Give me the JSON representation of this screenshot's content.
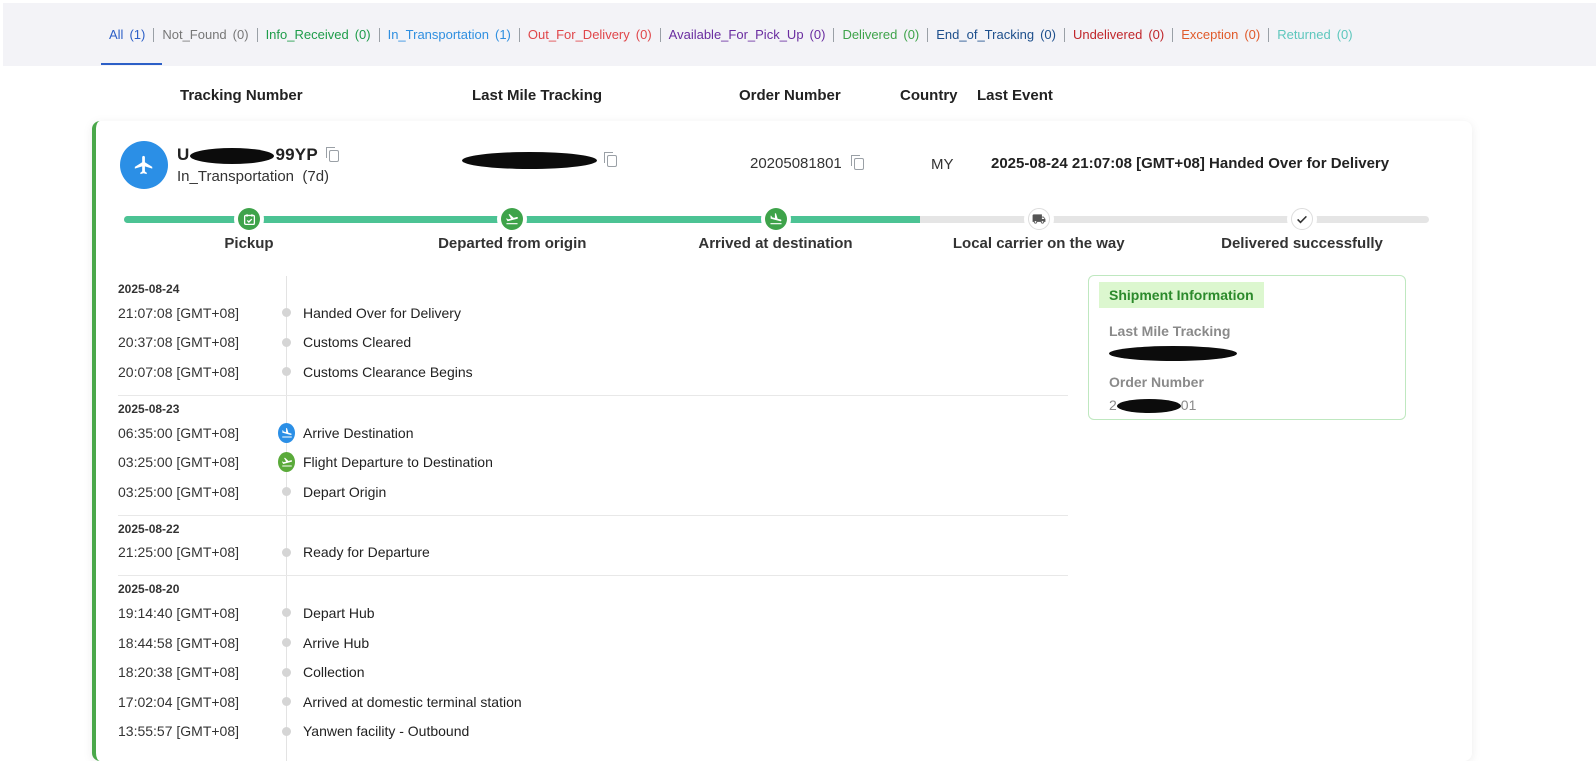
{
  "tabs": [
    {
      "label": "All",
      "count": "(1)",
      "color": "#2c5fc7",
      "active": true
    },
    {
      "label": "Not_Found",
      "count": "(0)",
      "color": "#777777"
    },
    {
      "label": "Info_Received",
      "count": "(0)",
      "color": "#1e9c4a"
    },
    {
      "label": "In_Transportation",
      "count": "(1)",
      "color": "#2f8fe0"
    },
    {
      "label": "Out_For_Delivery",
      "count": "(0)",
      "color": "#e0464a"
    },
    {
      "label": "Available_For_Pick_Up",
      "count": "(0)",
      "color": "#6a2da0"
    },
    {
      "label": "Delivered",
      "count": "(0)",
      "color": "#3ea34a"
    },
    {
      "label": "End_of_Tracking",
      "count": "(0)",
      "color": "#1d4f8c"
    },
    {
      "label": "Undelivered",
      "count": "(0)",
      "color": "#c0262b"
    },
    {
      "label": "Exception",
      "count": "(0)",
      "color": "#e05a2a"
    },
    {
      "label": "Returned",
      "count": "(0)",
      "color": "#5ec7bd"
    }
  ],
  "columns": {
    "tracking_number": "Tracking Number",
    "last_mile": "Last Mile Tracking",
    "order_number": "Order Number",
    "country": "Country",
    "last_event": "Last Event"
  },
  "shipment": {
    "tracking_prefix": "U",
    "tracking_suffix": "99YP",
    "status": "In_Transportation",
    "duration": "(7d)",
    "order_number": "20205081801",
    "country": "MY",
    "last_event": "2025-08-24 21:07:08 [GMT+08] Handed Over for Delivery"
  },
  "progress": {
    "fraction": 0.61,
    "steps": [
      {
        "label": "Pickup",
        "icon": "calendar-check-icon",
        "done": true
      },
      {
        "label": "Departed from origin",
        "icon": "plane-departure-icon",
        "done": true
      },
      {
        "label": "Arrived at destination",
        "icon": "plane-arrival-icon",
        "done": true
      },
      {
        "label": "Local carrier on the way",
        "icon": "delivery-truck-icon",
        "done": false
      },
      {
        "label": "Delivered successfully",
        "icon": "checkmark-icon",
        "done": false
      }
    ]
  },
  "timeline": [
    {
      "date": "2025-08-24",
      "events": [
        {
          "time": "21:07:08 [GMT+08]",
          "desc": "Handed Over for Delivery",
          "mark": "dot"
        },
        {
          "time": "20:37:08 [GMT+08]",
          "desc": "Customs Cleared",
          "mark": "dot"
        },
        {
          "time": "20:07:08 [GMT+08]",
          "desc": "Customs Clearance Begins",
          "mark": "dot"
        }
      ]
    },
    {
      "date": "2025-08-23",
      "events": [
        {
          "time": "06:35:00 [GMT+08]",
          "desc": "Arrive Destination",
          "mark": "arrival"
        },
        {
          "time": "03:25:00 [GMT+08]",
          "desc": "Flight Departure to Destination",
          "mark": "departure"
        },
        {
          "time": "03:25:00 [GMT+08]",
          "desc": "Depart Origin",
          "mark": "dot"
        }
      ]
    },
    {
      "date": "2025-08-22",
      "events": [
        {
          "time": "21:25:00 [GMT+08]",
          "desc": "Ready for Departure",
          "mark": "dot"
        }
      ]
    },
    {
      "date": "2025-08-20",
      "events": [
        {
          "time": "19:14:40 [GMT+08]",
          "desc": "Depart Hub",
          "mark": "dot"
        },
        {
          "time": "18:44:58 [GMT+08]",
          "desc": "Arrive Hub",
          "mark": "dot"
        },
        {
          "time": "18:20:38 [GMT+08]",
          "desc": "Collection",
          "mark": "dot"
        },
        {
          "time": "17:02:04 [GMT+08]",
          "desc": "Arrived at domestic terminal station",
          "mark": "dot"
        },
        {
          "time": "13:55:57 [GMT+08]",
          "desc": "Yanwen facility - Outbound",
          "mark": "dot"
        }
      ]
    }
  ],
  "shipment_info": {
    "title": "Shipment Information",
    "last_mile_label": "Last Mile Tracking",
    "order_label": "Order Number",
    "order_prefix": "2",
    "order_suffix": "01"
  },
  "colors": {
    "accent_green": "#4cc394",
    "step_done": "#3ea34a",
    "arrival_blue": "#2b8fe6",
    "departure_green": "#5aaa3a"
  }
}
